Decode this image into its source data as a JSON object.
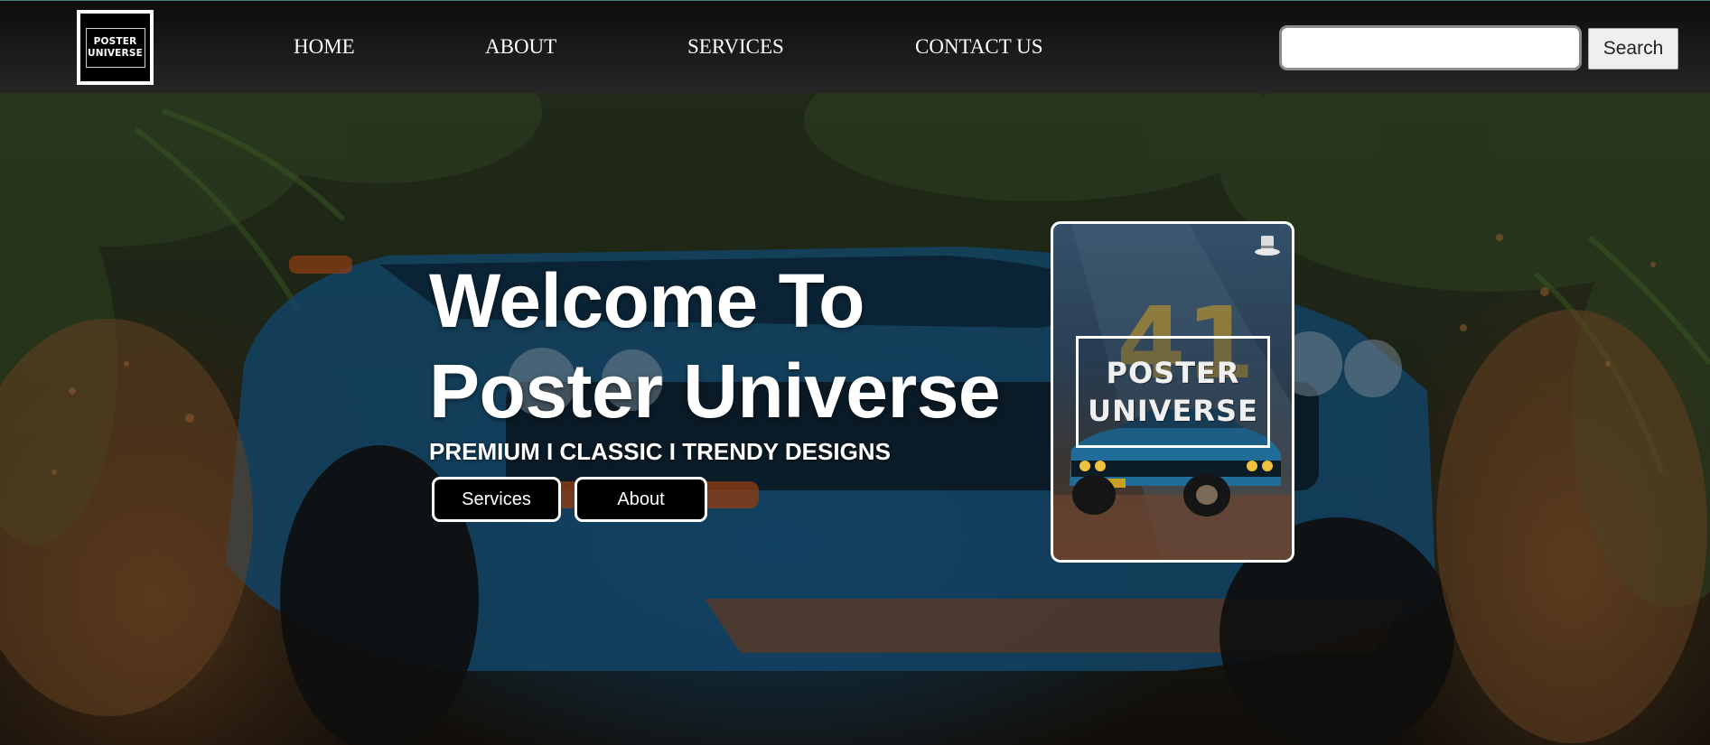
{
  "header": {
    "logo": {
      "line1": "POSTER",
      "line2": "UNIVERSE"
    },
    "nav": [
      {
        "label": "HOME"
      },
      {
        "label": "ABOUT"
      },
      {
        "label": "SERVICES"
      },
      {
        "label": "CONTACT US"
      }
    ],
    "search": {
      "value": "",
      "placeholder": "",
      "button_label": "Search"
    }
  },
  "hero": {
    "title_line1": "Welcome To",
    "title_line2": "Poster Universe",
    "subtitle": "PREMIUM I CLASSIC I TRENDY DESIGNS",
    "buttons": [
      {
        "label": "Services"
      },
      {
        "label": "About"
      }
    ],
    "background_image": "blue-muscle-car-off-road-jungle"
  },
  "poster_card": {
    "line1": "POSTER",
    "line2": "UNIVERSE",
    "icon": "top-hat-icon",
    "image": "blue-classic-car-on-dirt"
  },
  "colors": {
    "nav_bg": "#111111",
    "button_bg": "#000000",
    "button_border": "#ffffff",
    "text": "#ffffff",
    "car_blue": "#1d6ea0"
  }
}
